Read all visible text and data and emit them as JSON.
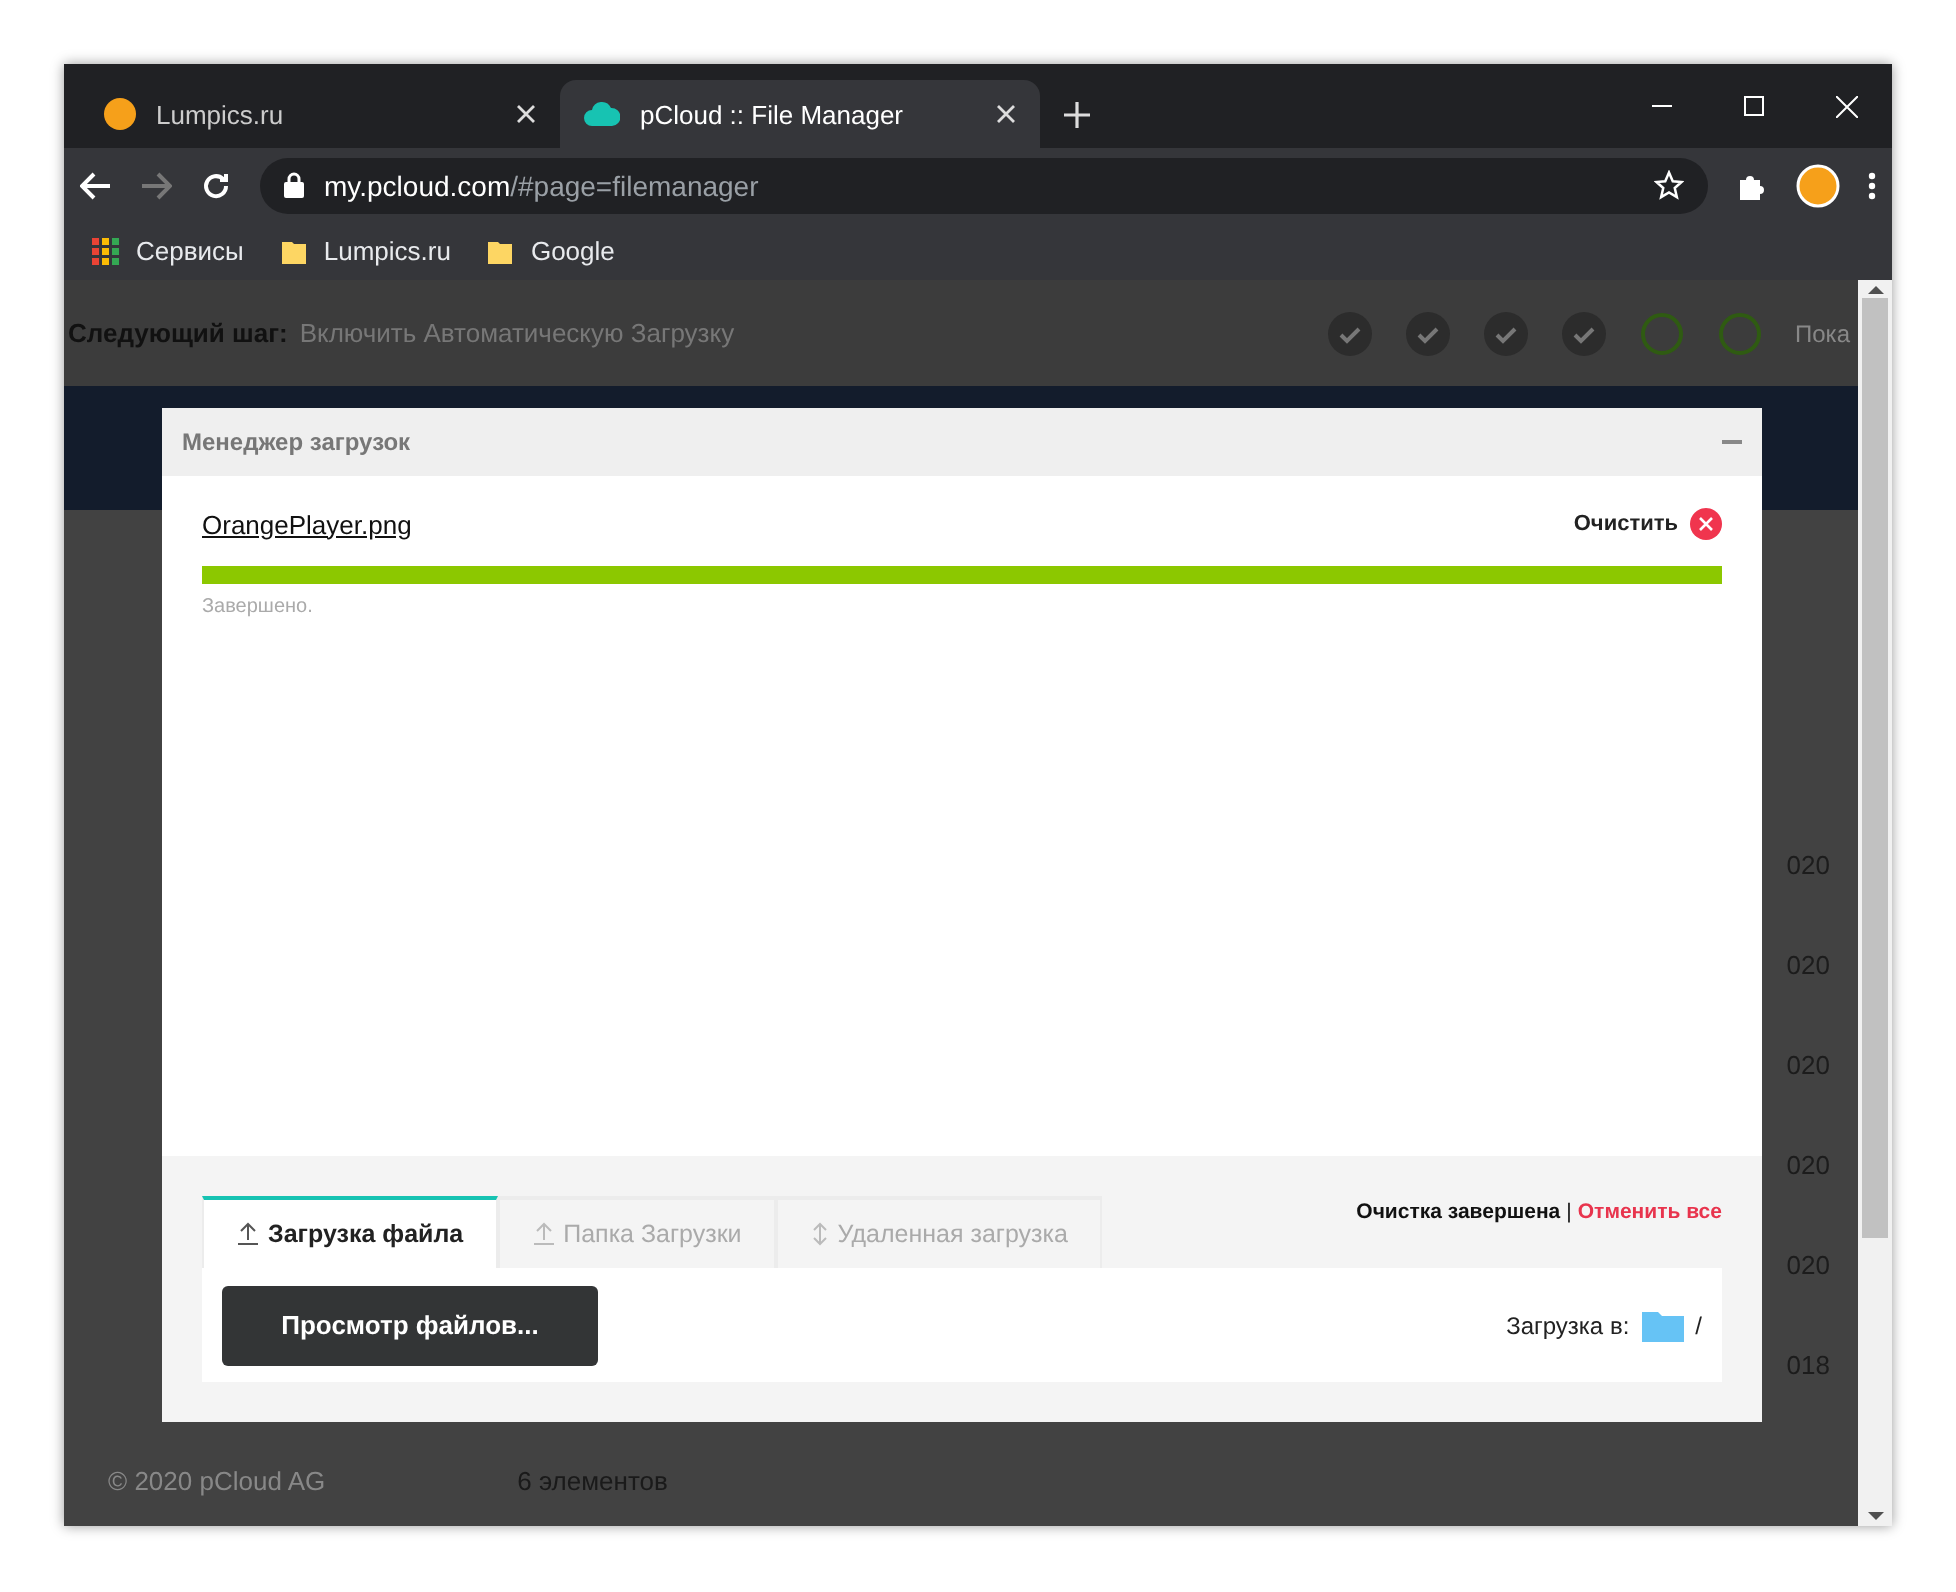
{
  "browser": {
    "tabs": [
      {
        "title": "Lumpics.ru",
        "selected": false,
        "kind": "orange"
      },
      {
        "title": "pCloud :: File Manager",
        "selected": true,
        "kind": "cloud"
      }
    ],
    "address": {
      "host": "my.pcloud.com",
      "path": "/#page=filemanager"
    },
    "bookmarks": [
      {
        "label": "Сервисы",
        "kind": "apps"
      },
      {
        "label": "Lumpics.ru",
        "kind": "folder"
      },
      {
        "label": "Google",
        "kind": "folder"
      }
    ]
  },
  "page": {
    "next_step": {
      "label": "Следующий шаг:",
      "value": "Включить Автоматическую Загрузку"
    },
    "steps": [
      {
        "done": true
      },
      {
        "done": true
      },
      {
        "done": true
      },
      {
        "done": true
      },
      {
        "done": false
      },
      {
        "done": false
      }
    ],
    "step_more": "Пока",
    "dates": [
      "020",
      "020",
      "020",
      "020",
      "020",
      "018"
    ],
    "copyright": "© 2020 pCloud AG",
    "count": "6 элементов"
  },
  "upload_manager": {
    "title": "Менеджер загрузок",
    "file": {
      "name": "OrangePlayer.png",
      "action": "Очистить",
      "level": 1,
      "status": "Завершено."
    },
    "tabs": [
      {
        "label": "Загрузка файла",
        "selected": true
      },
      {
        "label": "Папка Загрузки",
        "selected": false
      },
      {
        "label": "Удаленная загрузка",
        "selected": false
      }
    ],
    "summary": {
      "done": "Очистка завершена",
      "separator": "|",
      "cancel": "Отменить все"
    },
    "browse_button": "Просмотр файлов...",
    "destination": {
      "label": "Загрузка в:",
      "path": "/"
    }
  }
}
